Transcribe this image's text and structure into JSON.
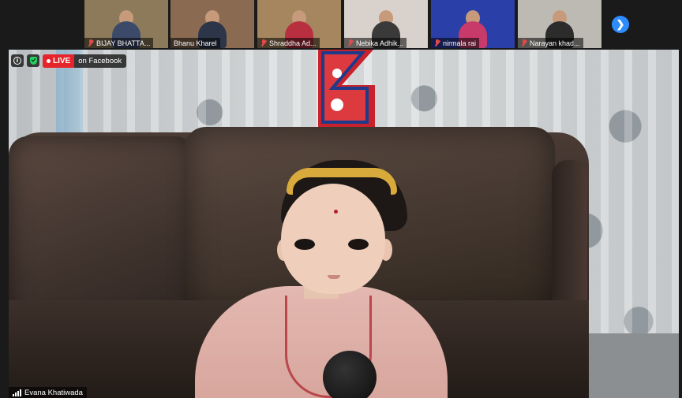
{
  "participants": [
    {
      "name": "BIJAY BHATTA...",
      "muted": true,
      "bg": "#8d7a5a",
      "shirt": "#3c4a6a"
    },
    {
      "name": "Bhanu Kharel",
      "muted": false,
      "bg": "#8a6b52",
      "shirt": "#2d3548"
    },
    {
      "name": "Shraddha Ad...",
      "muted": true,
      "bg": "#a5865e",
      "shirt": "#b83040"
    },
    {
      "name": "Nebika Adhik...",
      "muted": true,
      "bg": "#d9d2cc",
      "shirt": "#3a3a3a"
    },
    {
      "name": "nirmala rai",
      "muted": true,
      "bg": "#2b3fa8",
      "shirt": "#c83a6a"
    },
    {
      "name": "Narayan khad...",
      "muted": true,
      "bg": "#bdbab4",
      "shirt": "#2c2c2c"
    }
  ],
  "next_page_icon": "chevron-right-icon",
  "overlay": {
    "live_label": "LIVE",
    "stream_target": "on Facebook"
  },
  "active_speaker": {
    "name": "Evana Khatiwada"
  },
  "colors": {
    "accent_blue": "#2d8cff",
    "live_red": "#e5242b",
    "secure_green": "#23d160",
    "muted_red": "#e24a4a"
  }
}
